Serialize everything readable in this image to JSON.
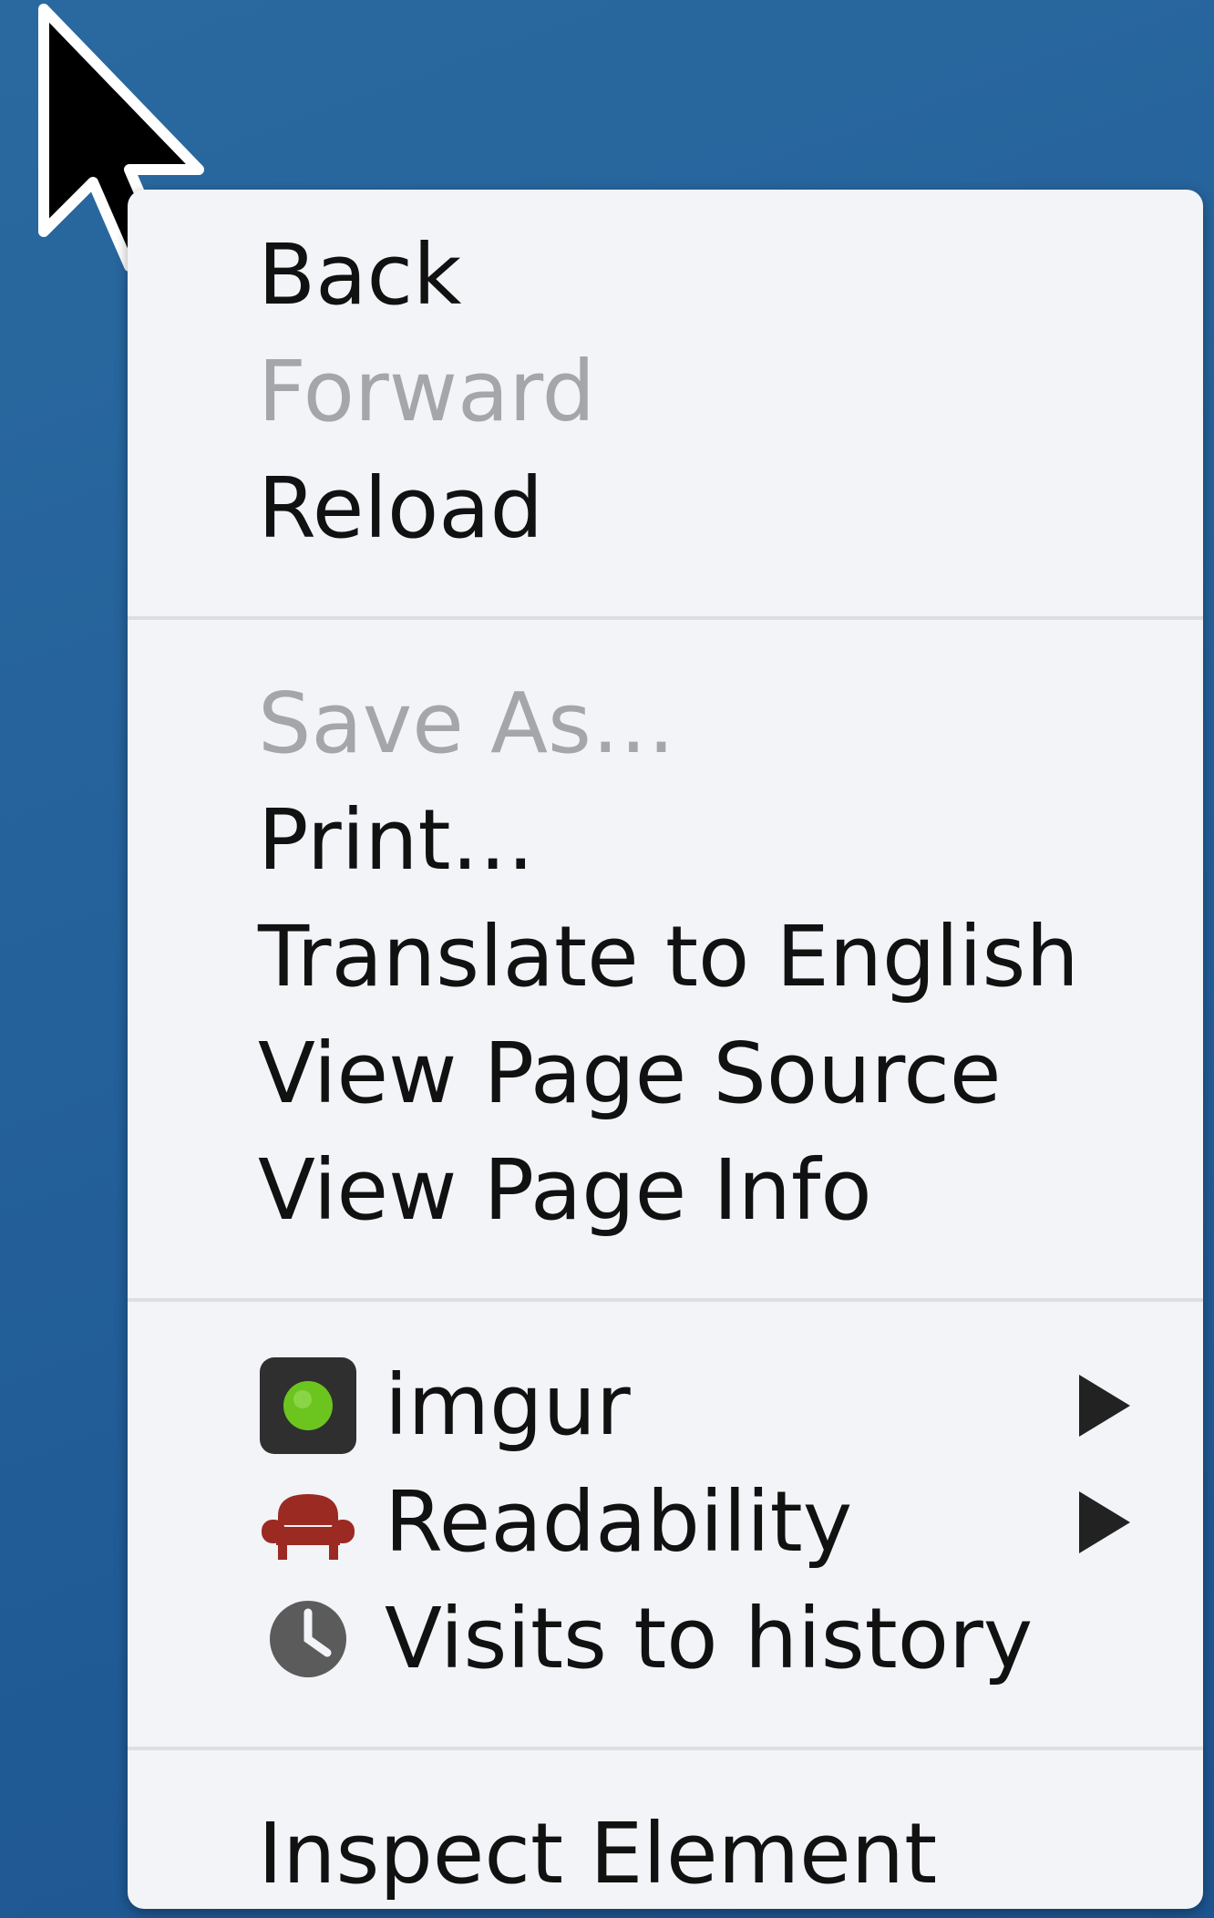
{
  "menu": {
    "back_label": "Back",
    "forward_label": "Forward",
    "reload_label": "Reload",
    "save_as_label": "Save As…",
    "print_label": "Print…",
    "translate_label": "Translate to English",
    "view_source_label": "View Page Source",
    "view_info_label": "View Page Info",
    "imgur_label": "imgur",
    "readability_label": "Readability",
    "visits_label": "Visits to history",
    "inspect_label": "Inspect Element"
  },
  "icons": {
    "imgur": "imgur-icon",
    "readability": "readability-armchair-icon",
    "visits": "clock-icon",
    "submenu": "submenu-arrow-icon",
    "cursor": "mouse-pointer-icon"
  },
  "colors": {
    "background": "#24609a",
    "menu_background": "#f2f4f7",
    "disabled_text": "#a4a6aa",
    "imgur_green": "#6cc51e",
    "readability_red": "#9b2a22"
  }
}
